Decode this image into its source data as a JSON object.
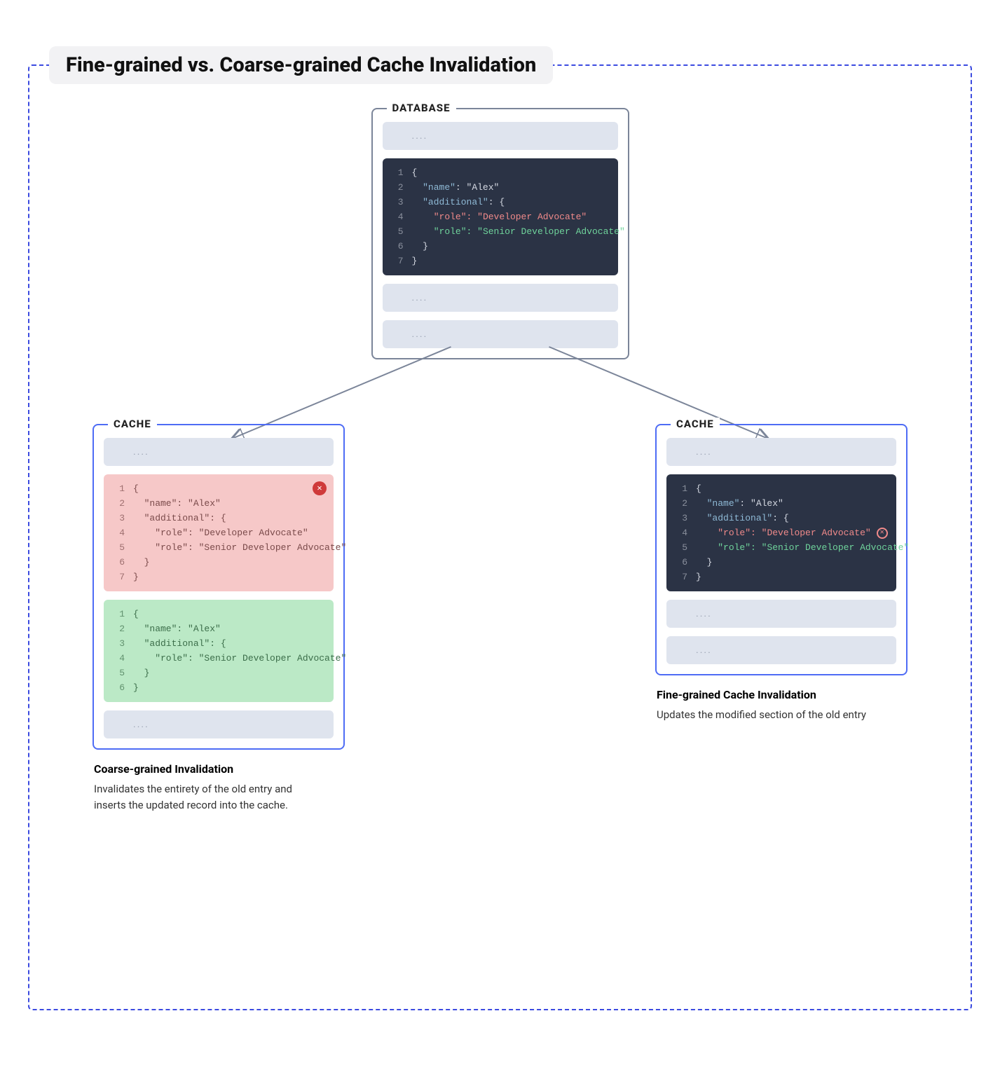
{
  "title": "Fine-grained vs. Coarse-grained Cache Invalidation",
  "placeholder": "....",
  "labels": {
    "database": "DATABASE",
    "cache": "CACHE"
  },
  "db_code": {
    "l1": "{",
    "l2_key": "\"name\"",
    "l2_sep": ": ",
    "l2_val": "\"Alex\"",
    "l3_key": "\"additional\"",
    "l3_sep": ": {",
    "l4_key": "\"role\"",
    "l4_sep": ": ",
    "l4_val": "\"Developer Advocate\"",
    "l5_key": "\"role\"",
    "l5_sep": ": ",
    "l5_val": "\"Senior Developer Advocate\"",
    "l6": "}",
    "l7": "}"
  },
  "coarse_red": {
    "l1": "{",
    "l2": "  \"name\": \"Alex\"",
    "l3": "  \"additional\": {",
    "l4": "    \"role\": \"Developer Advocate\"",
    "l5": "    \"role\": \"Senior Developer Advocate\"",
    "l6": "  }",
    "l7": "}"
  },
  "coarse_green": {
    "l1": "{",
    "l2": "  \"name\": \"Alex\"",
    "l3": "  \"additional\": {",
    "l4": "    \"role\": \"Senior Developer Advocate\"",
    "l5": "  }",
    "l6": "}"
  },
  "fine_code": {
    "l1": "{",
    "l2_key": "\"name\"",
    "l2_sep": ": ",
    "l2_val": "\"Alex\"",
    "l3_key": "\"additional\"",
    "l3_sep": ": {",
    "l4_key": "\"role\"",
    "l4_sep": ": ",
    "l4_val": "\"Developer Advocate\"",
    "l5_key": "\"role\"",
    "l5_sep": ": ",
    "l5_val": "\"Senior Developer Advocate\"",
    "l6": "}",
    "l7": "}"
  },
  "captions": {
    "coarse_title": "Coarse-grained Invalidation",
    "coarse_body": "Invalidates the entirety of the old entry and inserts the updated record into the cache.",
    "fine_title": "Fine-grained Cache Invalidation",
    "fine_body": "Updates the modified section of the old entry"
  },
  "ln": {
    "n1": "1",
    "n2": "2",
    "n3": "3",
    "n4": "4",
    "n5": "5",
    "n6": "6",
    "n7": "7"
  }
}
